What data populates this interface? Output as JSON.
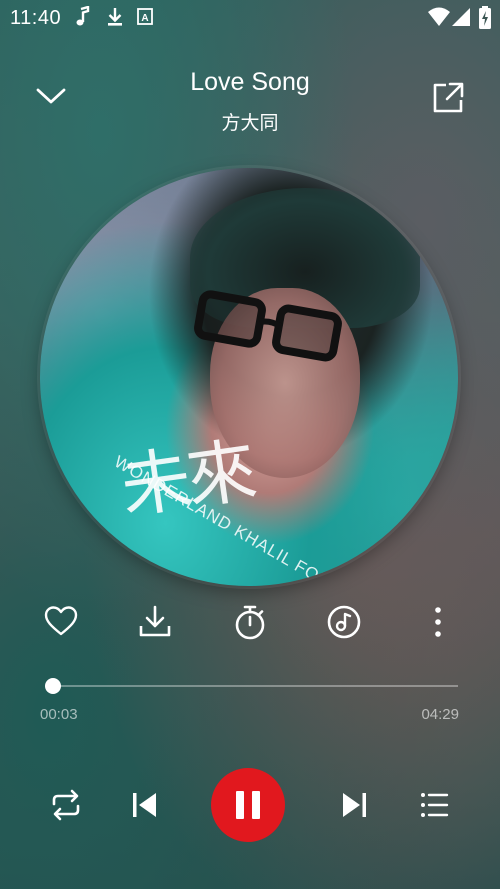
{
  "status_bar": {
    "time": "11:40",
    "icons": [
      "music-note-icon",
      "download-icon",
      "app-a-icon",
      "wifi-icon",
      "signal-icon",
      "battery-icon"
    ]
  },
  "player": {
    "title": "Love Song",
    "artist": "方大同"
  },
  "cover": {
    "text": "未來",
    "subtitle": "WONDERLAND KHALIL FONG"
  },
  "actions": [
    "favorite-icon",
    "download-icon",
    "timer-icon",
    "sound-effect-icon",
    "more-icon"
  ],
  "progress": {
    "current": "00:03",
    "total": "04:29",
    "fraction": 0.011
  },
  "controls": [
    "repeat-icon",
    "previous-icon",
    "pause-icon",
    "next-icon",
    "playlist-icon"
  ],
  "colors": {
    "accent": "#e1181e"
  }
}
